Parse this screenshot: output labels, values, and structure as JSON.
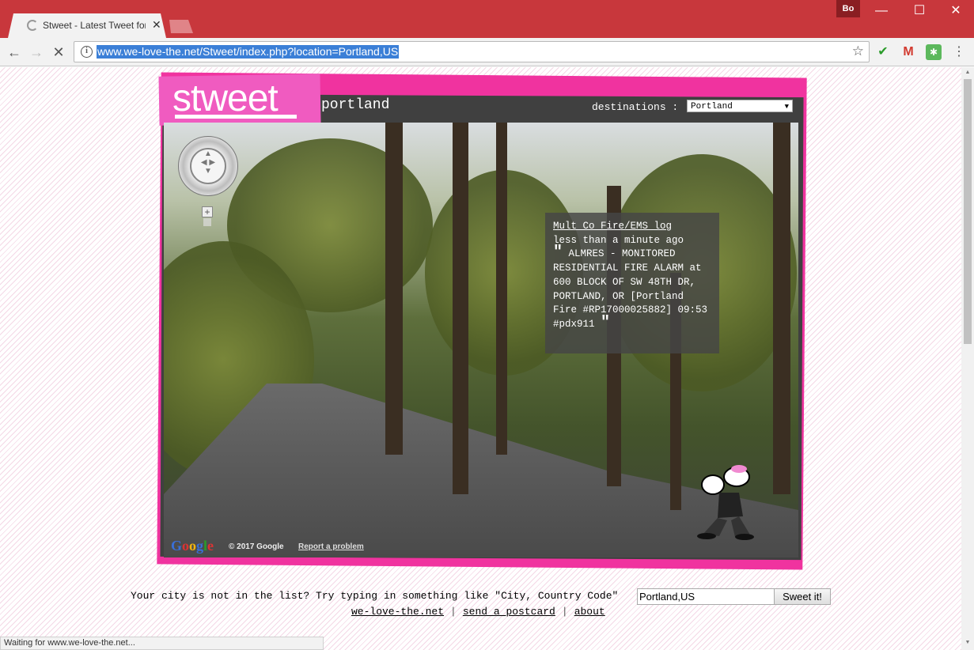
{
  "browser": {
    "tab_title": "Stweet - Latest Tweet for",
    "profile": "Bo",
    "url": "www.we-love-the.net/Stweet/index.php?location=Portland,US",
    "status": "Waiting for www.we-love-the.net..."
  },
  "page": {
    "logo": "stweet",
    "city": "portland",
    "destinations_label": "destinations :",
    "destination_selected": "Portland",
    "tweet": {
      "author": "Mult Co Fire/EMS log",
      "time": "less than a minute ago",
      "text": "ALMRES - MONITORED RESIDENTIAL FIRE ALARM at 600 BLOCK OF SW 48TH DR, PORTLAND, OR [Portland Fire #RP17000025882] 09:53 #pdx911"
    },
    "map": {
      "google": "Google",
      "copyright": "© 2017 Google",
      "report": "Report a problem"
    },
    "footer": {
      "prompt": "Your city is not in the list? Try typing in something like \"City, Country Code\"",
      "input_value": "Portland,US",
      "button": "Sweet it!",
      "links": [
        "we-love-the.net",
        "send a postcard",
        "about"
      ]
    }
  }
}
